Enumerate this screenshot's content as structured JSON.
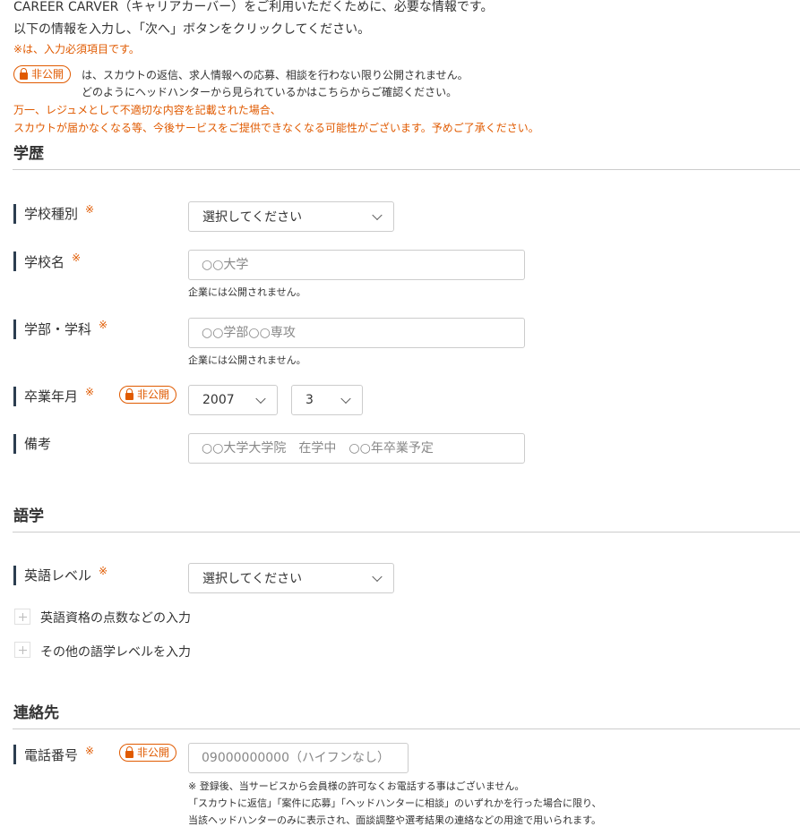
{
  "intro": {
    "line1": "CAREER CARVER（キャリアカーバー）をご利用いただくために、必要な情報です。",
    "line2": "以下の情報を入力し、「次へ」ボタンをクリックしてください。",
    "required_note": "※は、入力必須項目です。",
    "badge_label": "非公開",
    "private_line1": "は、スカウトの返信、求人情報への応募、相談を行わない限り公開されません。",
    "private_line2": "どのようにヘッドハンターから見られているかはこちらからご確認ください。",
    "warning1": "万一、レジュメとして不適切な内容を記載された場合、",
    "warning2": "スカウトが届かなくなる等、今後サービスをご提供できなくなる可能性がございます。予めご了承ください。"
  },
  "sections": {
    "education": "学歴",
    "language": "語学",
    "contact": "連絡先"
  },
  "required_mark": "※",
  "private_badge": "非公開",
  "education": {
    "school_type": {
      "label": "学校種別",
      "value": "選択してください"
    },
    "school_name": {
      "label": "学校名",
      "placeholder": "○○大学",
      "note": "企業には公開されません。"
    },
    "faculty": {
      "label": "学部・学科",
      "placeholder": "○○学部○○専攻",
      "note": "企業には公開されません。"
    },
    "graduation": {
      "label": "卒業年月",
      "year": "2007",
      "month": "3"
    },
    "remarks": {
      "label": "備考",
      "placeholder": "○○大学大学院　在学中　○○年卒業予定"
    }
  },
  "language": {
    "english_level": {
      "label": "英語レベル",
      "value": "選択してください"
    },
    "expand1": "英語資格の点数などの入力",
    "expand2": "その他の語学レベルを入力"
  },
  "contact": {
    "phone": {
      "label": "電話番号",
      "placeholder": "09000000000（ハイフンなし）",
      "note1": "※ 登録後、当サービスから会員様の許可なくお電話する事はございません。",
      "note2": "「スカウトに返信」「案件に応募」「ヘッドハンターに相談」のいずれかを行った場合に限り、",
      "note3": "当該ヘッドハンターのみに表示され、面談調整や選考結果の連絡などの用途で用いられます。"
    }
  }
}
